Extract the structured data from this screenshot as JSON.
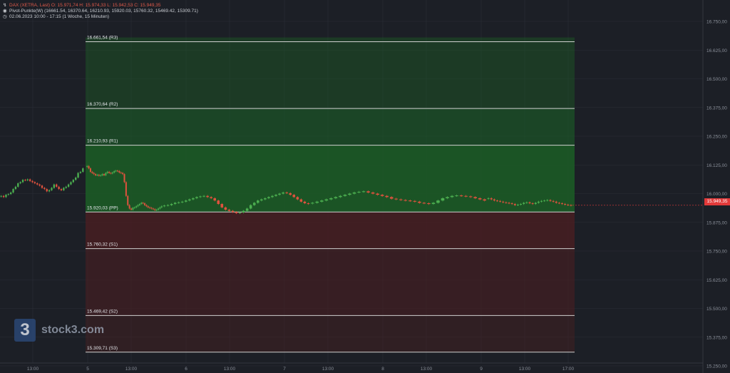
{
  "header": {
    "symbol_line": "DAX (XETRA, Last)  O: 15.971,74  H: 15.974,33  L: 15.942,53  C: 15.949,35",
    "indicator_line": "Pivot-Punkte(W)  (16661.54,  16370.64,  16210.93,  15920.03,  15760.32,  15469.42,  15309.71)",
    "period_line": "02.06.2023 10:00 - 17:15   (1 Woche, 15 Minuten)"
  },
  "watermark": {
    "mark": "3",
    "text": "stock3.com"
  },
  "current_price_label": "15.949,35",
  "colors": {
    "background": "#1c1f26",
    "zone_upper": "#1c5a26",
    "zone_lower": "#4a1e22",
    "candle_up": "#4caf50",
    "candle_down": "#e0523e",
    "pivot_line": "#d0d0d0",
    "price_tag": "#e23a3a"
  },
  "chart_data": {
    "type": "candlestick",
    "title": "",
    "xlabel": "",
    "ylabel": "",
    "ylim": [
      15250,
      16750
    ],
    "grid": true,
    "y_ticks": [
      "16.750,00",
      "16.625,00",
      "16.500,00",
      "16.375,00",
      "16.250,00",
      "16.125,00",
      "16.000,00",
      "15.875,00",
      "15.750,00",
      "15.625,00",
      "15.500,00",
      "15.375,00",
      "15.250,00"
    ],
    "x_ticks": [
      "13:00",
      "5",
      "13:00",
      "6",
      "13:00",
      "7",
      "13:00",
      "8",
      "13:00",
      "9",
      "13:00",
      "17:00"
    ],
    "pivot_levels": [
      {
        "label": "16.661,54 (R3)",
        "value": 16661.54
      },
      {
        "label": "16.370,64 (R2)",
        "value": 16370.64
      },
      {
        "label": "16.210,93 (R1)",
        "value": 16210.93
      },
      {
        "label": "15.920,03 (PP)",
        "value": 15920.03
      },
      {
        "label": "15.760,32 (S1)",
        "value": 15760.32
      },
      {
        "label": "15.469,42 (S2)",
        "value": 15469.42
      },
      {
        "label": "15.309,71 (S3)",
        "value": 15309.71
      }
    ],
    "last_price": 15949.35,
    "series": [
      {
        "values": [
          15990,
          15985,
          15995,
          15998,
          16005,
          16020,
          16030,
          16045,
          16050,
          16060,
          16058,
          16062,
          16055,
          16050,
          16045,
          16040,
          16035,
          16025,
          16020,
          16010,
          16015,
          16025,
          16040,
          16030,
          16020,
          16015,
          16025,
          16030,
          16040,
          16050,
          16060,
          16070,
          16090,
          16095,
          16110
        ]
      },
      {
        "values": [
          16120,
          16110,
          16095,
          16090,
          16085,
          16080,
          16082,
          16078,
          16080,
          16085,
          16080,
          16090,
          16095,
          16090,
          16088,
          16092,
          16098,
          16100,
          16098,
          16092,
          16090,
          16085,
          16050,
          15990,
          15950,
          15935,
          15930,
          15938,
          15940,
          15945,
          15950,
          15955,
          15960,
          15958,
          15950,
          15945,
          15940,
          15938,
          15935,
          15932,
          15928,
          15930,
          15935,
          15940,
          15945
        ]
      },
      {
        "values": [
          15948,
          15950,
          15955,
          15960,
          15962,
          15965,
          15970,
          15975,
          15980,
          15985,
          15988,
          15990,
          15985,
          15980,
          15970,
          15955,
          15940,
          15930,
          15925,
          15920,
          15915,
          15918,
          15925,
          15935,
          15950,
          15960,
          15970,
          15975,
          15980,
          15985,
          15990,
          15995,
          16000,
          16005,
          16002,
          15995,
          15985,
          15975,
          15965,
          15958,
          15955
        ]
      },
      {
        "values": [
          15960,
          15965,
          15970,
          15975,
          15980,
          15985,
          15990,
          15995,
          16000,
          16005,
          16008,
          16010,
          16005,
          16000,
          15995,
          15990,
          15985,
          15978,
          15975,
          15972,
          15970,
          15968,
          15965,
          15960,
          15958,
          15955,
          15960,
          15970,
          15980,
          15985,
          15990,
          15992,
          15990,
          15988,
          15985,
          15980,
          15975,
          15970
        ]
      },
      {
        "values": [
          15980,
          15975,
          15970,
          15968,
          15965,
          15962,
          15960,
          15958,
          15955,
          15950,
          15952,
          15955,
          15960,
          15962,
          15958,
          15955,
          15960,
          15965,
          15968,
          15970,
          15972,
          15968,
          15965,
          15960,
          15958,
          15955,
          15952,
          15950,
          15949
        ]
      }
    ]
  }
}
